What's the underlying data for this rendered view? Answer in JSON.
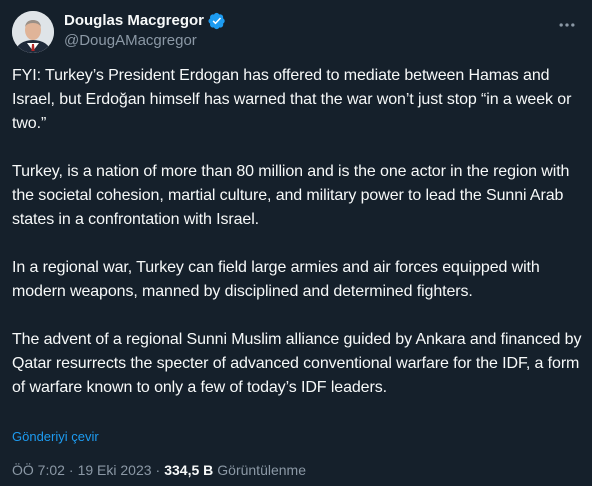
{
  "author": {
    "display_name": "Douglas Macgregor",
    "handle": "@DougAMacgregor",
    "verified": true,
    "verified_color": "#1d9bf0"
  },
  "tweet": {
    "paragraphs": [
      "FYI: Turkey’s President Erdogan has offered to mediate between Hamas and Israel, but Erdoğan himself has warned that the war won’t just stop “in a week or two.”",
      "Turkey, is a nation of more than 80 million and is the one actor in the region with the societal cohesion, martial culture, and military power to lead the Sunni Arab states in a confrontation with Israel.",
      "In a regional war, Turkey can field large armies and air forces equipped with modern weapons, manned by disciplined and determined fighters.",
      "The advent of a regional Sunni Muslim alliance guided by Ankara and financed by Qatar resurrects the specter of advanced conventional warfare for the IDF, a form of warfare known to only a few of today’s IDF leaders."
    ],
    "translate_label": "Gönderiyi çevir"
  },
  "meta": {
    "time": "ÖÖ 7:02",
    "separator": "·",
    "date": "19 Eki 2023",
    "views_count": "334,5 B",
    "views_label": "Görüntülenme"
  },
  "icons": {
    "more": "more-horizontal-icon",
    "verified": "verified-badge-icon"
  },
  "colors": {
    "background": "#15202b",
    "text_primary": "#f7f9f9",
    "text_secondary": "#8b98a5",
    "accent": "#1d9bf0"
  }
}
